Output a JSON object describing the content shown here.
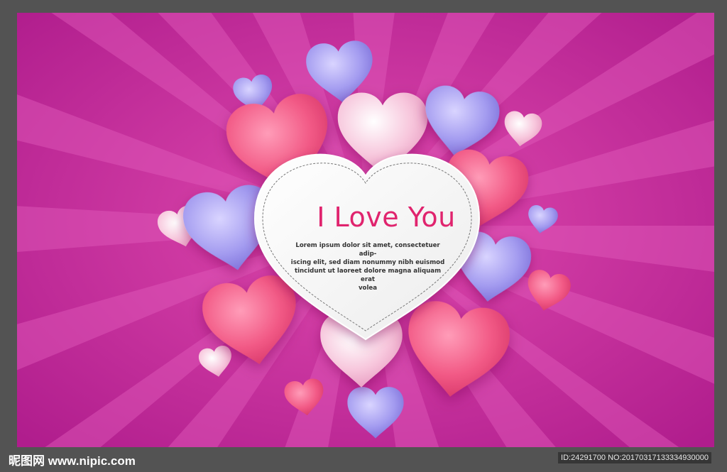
{
  "card": {
    "title": "I Love You",
    "body": "Lorem ipsum dolor sit amet, consectetuer adip-\nis­cing elit, sed diam nonummy nibh euismod\ntincidunt ut laoreet dolore magna aliquam erat\nvolea"
  },
  "watermark": {
    "site": "昵图网 www.nipic.com",
    "id_text": "ID:24291700 NO:20170317133334930000"
  },
  "colors": {
    "background": "#c8249a",
    "ray_light": "#dd4fb4",
    "title": "#e0246e",
    "heart_pink": "#f25a86",
    "heart_light_pink": "#f7c6dc",
    "heart_lavender": "#8f86e6"
  }
}
